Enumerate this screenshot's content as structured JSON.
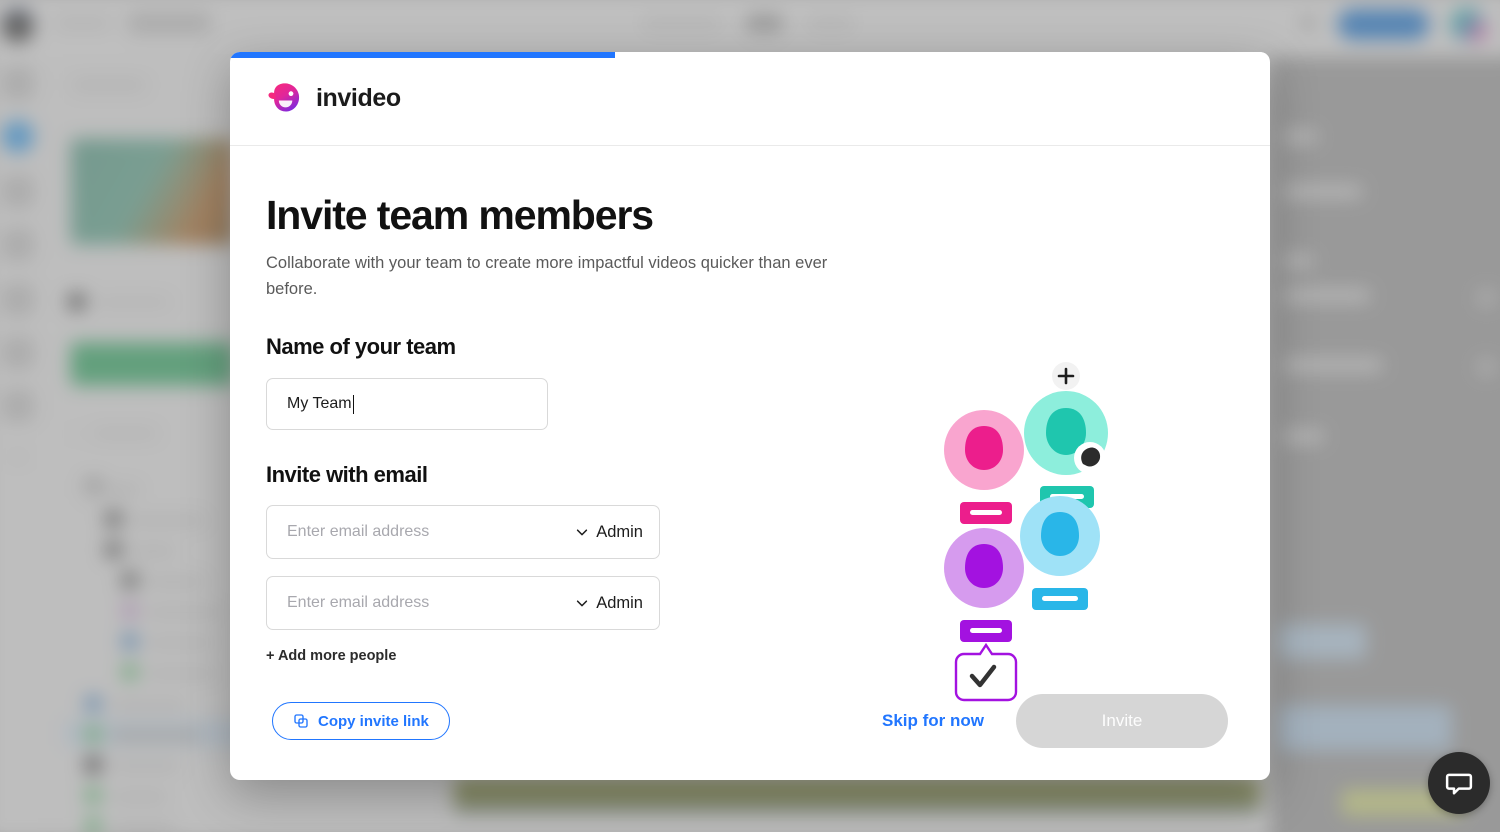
{
  "modal": {
    "progress_percent": 37,
    "accent_color": "#2176ff",
    "brand": {
      "name": "invideo",
      "logo_icon": "invideo-blob-logo"
    },
    "title": "Invite team members",
    "subtitle": "Collaborate with your team to create more impactful videos quicker than ever before.",
    "team_section": {
      "label": "Name of your team",
      "input_value": "My Team",
      "input_placeholder": "Name of your team"
    },
    "email_section": {
      "label": "Invite with email",
      "rows": [
        {
          "placeholder": "Enter email address",
          "value": "",
          "role": "Admin",
          "role_icon": "chevron-down-icon"
        },
        {
          "placeholder": "Enter email address",
          "value": "",
          "role": "Admin",
          "role_icon": "chevron-down-icon"
        }
      ],
      "add_more_label": "+ Add more people"
    },
    "footer": {
      "copy_link_label": "Copy invite link",
      "copy_link_icon": "copy-icon",
      "skip_label": "Skip for now",
      "invite_label": "Invite",
      "invite_disabled": true
    },
    "illustration": {
      "name": "team-avatars-illustration",
      "add_badge": "+",
      "check_badge": "✓",
      "avatars": [
        {
          "name": "avatar-pink",
          "color": "#ec1e8c",
          "halo": "#f9a5cf"
        },
        {
          "name": "avatar-teal",
          "color": "#1fc6ae",
          "halo": "#8deedc"
        },
        {
          "name": "avatar-blue",
          "color": "#29b6e8",
          "halo": "#9fe2f7"
        },
        {
          "name": "avatar-purple",
          "color": "#a312e0",
          "halo": "#d69bee"
        }
      ]
    }
  },
  "background_app": {
    "chat_widget_icon": "chat-bubble-icon"
  }
}
